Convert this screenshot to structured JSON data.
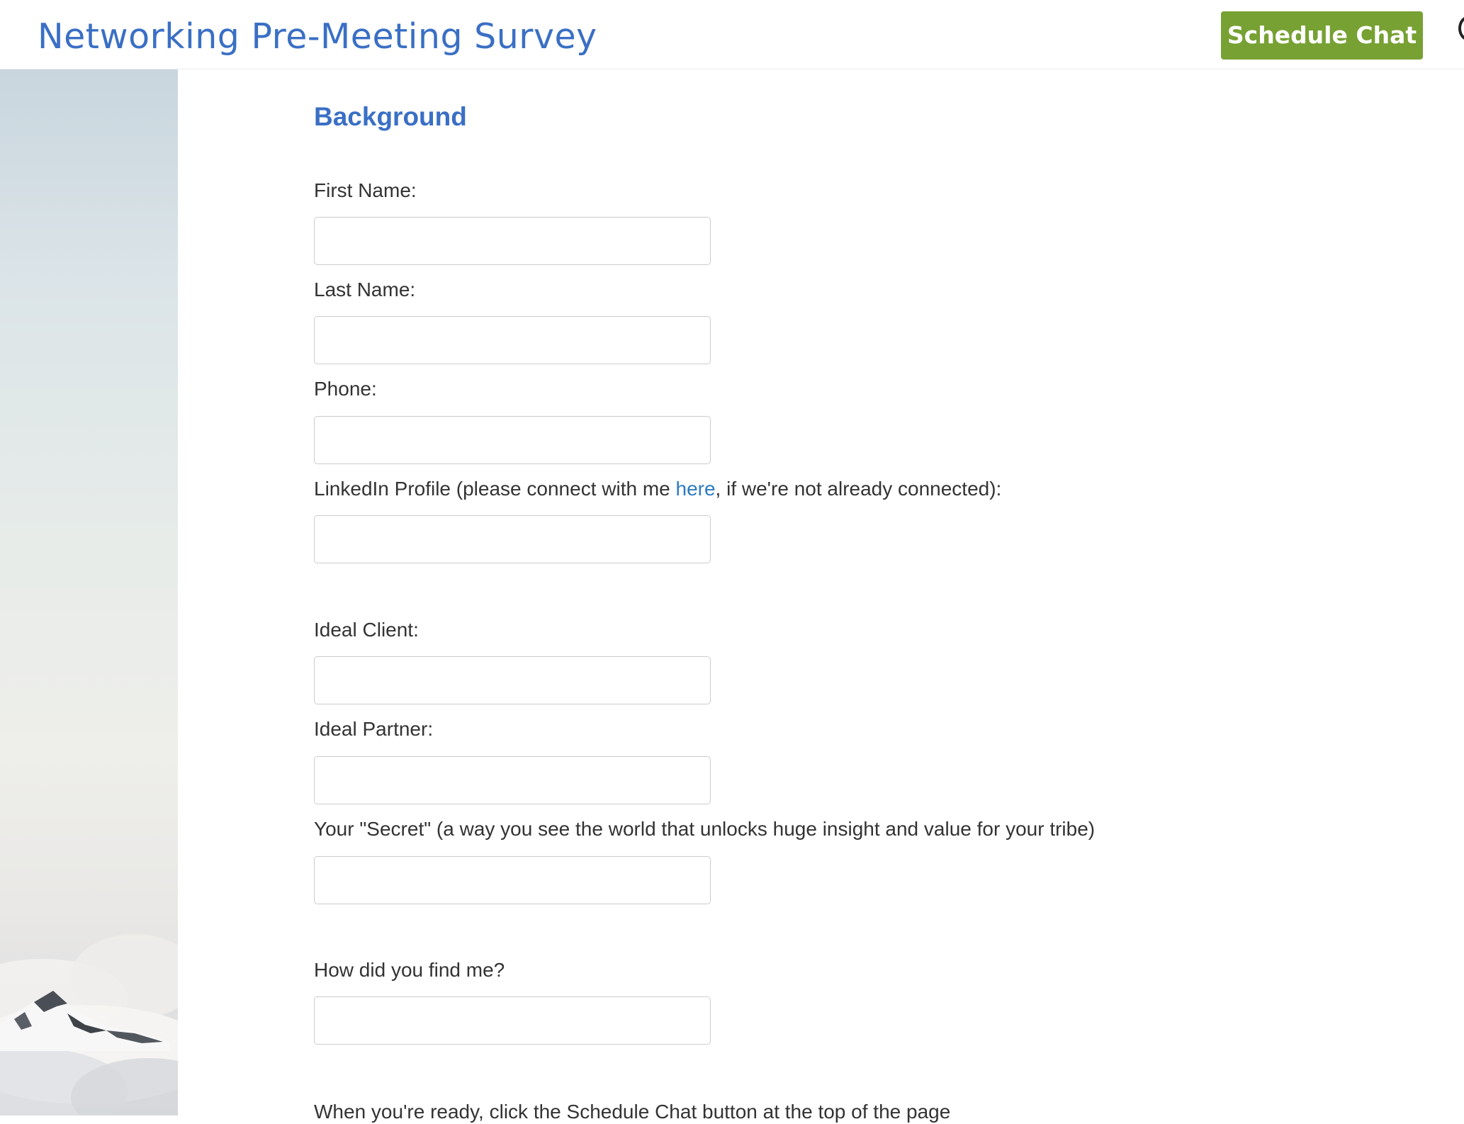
{
  "header": {
    "title": "Networking Pre-Meeting Survey",
    "schedule_button_label": "Schedule Chat",
    "brand_color": "#3a6fc4",
    "button_color": "#77a133"
  },
  "form": {
    "section_title": "Background",
    "fields": {
      "first_name": {
        "label": "First Name:",
        "value": ""
      },
      "last_name": {
        "label": "Last Name:",
        "value": ""
      },
      "phone": {
        "label": "Phone:",
        "value": ""
      },
      "linkedin": {
        "label_prefix": "LinkedIn Profile (please connect with me ",
        "link_text": "here",
        "label_suffix": ", if we're not already connected):",
        "value": ""
      },
      "ideal_client": {
        "label": "Ideal Client:",
        "value": ""
      },
      "ideal_partner": {
        "label": "Ideal Partner:",
        "value": ""
      },
      "secret": {
        "label": "Your \"Secret\" (a way you see the world that unlocks huge insight and value for your tribe)",
        "value": ""
      },
      "found_me": {
        "label": "How did you find me?",
        "value": ""
      }
    },
    "footer_note": "When you're ready, click the Schedule Chat button at the top of the page"
  },
  "decor": {
    "side_image": "mountain-clouds-image"
  }
}
